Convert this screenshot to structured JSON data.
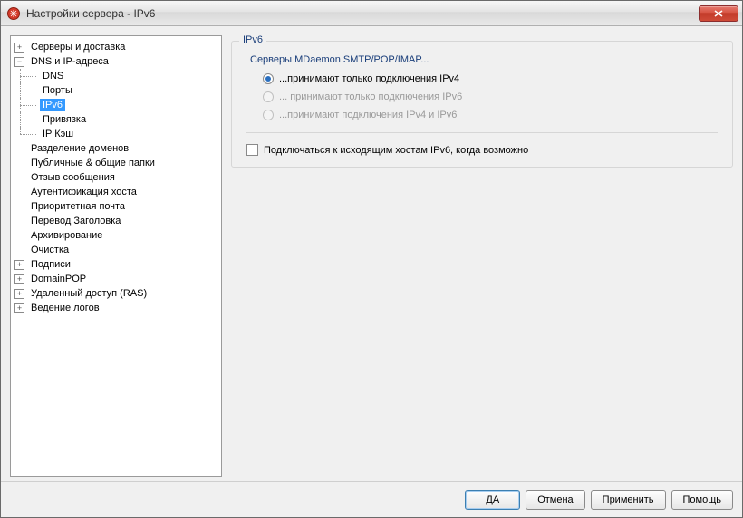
{
  "window": {
    "title": "Настройки сервера - IPv6"
  },
  "tree": {
    "items": [
      {
        "label": "Серверы и доставка",
        "expandable": true,
        "expanded": false
      },
      {
        "label": "DNS и IP-адреса",
        "expandable": true,
        "expanded": true,
        "children": [
          {
            "label": "DNS"
          },
          {
            "label": "Порты"
          },
          {
            "label": "IPv6",
            "selected": true
          },
          {
            "label": "Привязка"
          },
          {
            "label": "IP Кэш",
            "last": true
          }
        ]
      },
      {
        "label": "Разделение доменов",
        "expandable": false
      },
      {
        "label": "Публичные & общие папки",
        "expandable": false
      },
      {
        "label": "Отзыв сообщения",
        "expandable": false
      },
      {
        "label": "Аутентификация хоста",
        "expandable": false
      },
      {
        "label": "Приоритетная почта",
        "expandable": false
      },
      {
        "label": "Перевод Заголовка",
        "expandable": false
      },
      {
        "label": "Архивирование",
        "expandable": false
      },
      {
        "label": "Очистка",
        "expandable": false
      },
      {
        "label": "Подписи",
        "expandable": true,
        "expanded": false
      },
      {
        "label": "DomainPOP",
        "expandable": true,
        "expanded": false
      },
      {
        "label": "Удаленный доступ (RAS)",
        "expandable": true,
        "expanded": false
      },
      {
        "label": "Ведение логов",
        "expandable": true,
        "expanded": false
      }
    ]
  },
  "panel": {
    "group_title": "IPv6",
    "subtitle": "Серверы MDaemon SMTP/POP/IMAP...",
    "radios": [
      {
        "label": "...принимают только подключения IPv4",
        "selected": true,
        "disabled": false
      },
      {
        "label": "... принимают только подключения IPv6",
        "selected": false,
        "disabled": true
      },
      {
        "label": "...принимают подключения IPv4 и IPv6",
        "selected": false,
        "disabled": true
      }
    ],
    "checkbox": {
      "label": "Подключаться к исходящим хостам IPv6, когда возможно",
      "checked": false
    }
  },
  "buttons": {
    "ok": "ДА",
    "cancel": "Отмена",
    "apply": "Применить",
    "help": "Помощь"
  }
}
